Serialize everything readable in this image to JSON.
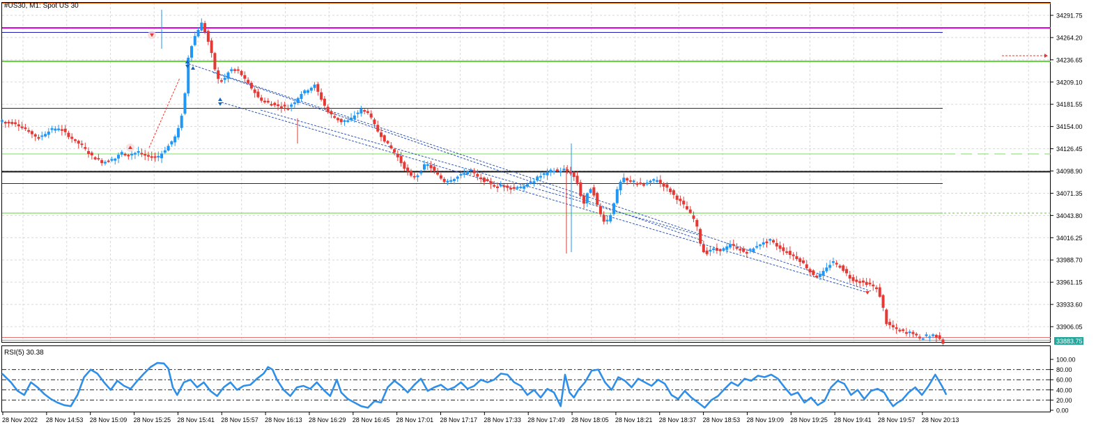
{
  "chart": {
    "symbol_label": "#US30, M1:  Spot US 30",
    "price_axis": [
      "34291.75",
      "34264.20",
      "34236.65",
      "34209.10",
      "34181.55",
      "34154.00",
      "34126.45",
      "34098.90",
      "34071.35",
      "34043.80",
      "34016.25",
      "33988.70",
      "33961.15",
      "33933.60",
      "33906.05"
    ],
    "current_price": "33883.75",
    "colors": {
      "bull": "#2196f3",
      "bear": "#e53935",
      "accent": "#26a69a"
    }
  },
  "rsi": {
    "label": "RSI(5) 30.38",
    "axis": [
      "100.00",
      "80.00",
      "60.00",
      "40.00",
      "20.00",
      "0.00"
    ]
  },
  "time_axis": [
    "28 Nov 2022",
    "28 Nov 14:53",
    "28 Nov 15:09",
    "28 Nov 15:25",
    "28 Nov 15:41",
    "28 Nov 15:57",
    "28 Nov 16:13",
    "28 Nov 16:29",
    "28 Nov 16:45",
    "28 Nov 17:01",
    "28 Nov 17:17",
    "28 Nov 17:33",
    "28 Nov 17:49",
    "28 Nov 18:05",
    "28 Nov 18:21",
    "28 Nov 18:37",
    "28 Nov 18:53",
    "28 Nov 19:09",
    "28 Nov 19:25",
    "28 Nov 19:41",
    "28 Nov 19:57",
    "28 Nov 20:13"
  ],
  "chart_data": [
    {
      "type": "candlestick",
      "interval": "M1",
      "price_labels": [
        34291.75,
        34264.2,
        34236.65,
        34209.1,
        34181.55,
        34154.0,
        34126.45,
        34098.9,
        34071.35,
        34043.8,
        34016.25,
        33988.7,
        33961.15,
        33933.6,
        33906.05
      ],
      "ylim": [
        33883,
        34305
      ],
      "close_path": [
        [
          0,
          34160
        ],
        [
          12,
          34158
        ],
        [
          22,
          34150
        ],
        [
          32,
          34140
        ],
        [
          42,
          34148
        ],
        [
          52,
          34152
        ],
        [
          62,
          34140
        ],
        [
          72,
          34130
        ],
        [
          80,
          34118
        ],
        [
          90,
          34110
        ],
        [
          100,
          34112
        ],
        [
          108,
          34122
        ],
        [
          115,
          34118
        ],
        [
          122,
          34122
        ],
        [
          130,
          34118
        ],
        [
          140,
          34115
        ],
        [
          150,
          34130
        ],
        [
          158,
          34145
        ],
        [
          164,
          34180
        ],
        [
          168,
          34240
        ],
        [
          172,
          34260
        ],
        [
          176,
          34272
        ],
        [
          180,
          34282
        ],
        [
          184,
          34268
        ],
        [
          188,
          34250
        ],
        [
          192,
          34225
        ],
        [
          196,
          34208
        ],
        [
          200,
          34212
        ],
        [
          206,
          34225
        ],
        [
          214,
          34222
        ],
        [
          220,
          34210
        ],
        [
          226,
          34200
        ],
        [
          232,
          34188
        ],
        [
          240,
          34184
        ],
        [
          250,
          34180
        ],
        [
          258,
          34178
        ],
        [
          264,
          34185
        ],
        [
          270,
          34195
        ],
        [
          276,
          34200
        ],
        [
          282,
          34205
        ],
        [
          288,
          34188
        ],
        [
          294,
          34172
        ],
        [
          300,
          34165
        ],
        [
          306,
          34160
        ],
        [
          312,
          34160
        ],
        [
          318,
          34168
        ],
        [
          324,
          34175
        ],
        [
          330,
          34172
        ],
        [
          338,
          34150
        ],
        [
          346,
          34135
        ],
        [
          354,
          34122
        ],
        [
          362,
          34105
        ],
        [
          370,
          34090
        ],
        [
          376,
          34095
        ],
        [
          382,
          34108
        ],
        [
          388,
          34102
        ],
        [
          394,
          34092
        ],
        [
          400,
          34085
        ],
        [
          408,
          34090
        ],
        [
          416,
          34095
        ],
        [
          422,
          34100
        ],
        [
          430,
          34090
        ],
        [
          438,
          34085
        ],
        [
          446,
          34080
        ],
        [
          454,
          34080
        ],
        [
          462,
          34078
        ],
        [
          470,
          34078
        ],
        [
          478,
          34085
        ],
        [
          484,
          34092
        ],
        [
          490,
          34095
        ],
        [
          496,
          34100
        ],
        [
          502,
          34098
        ],
        [
          508,
          34100
        ],
        [
          514,
          34096
        ],
        [
          520,
          34082
        ],
        [
          524,
          34055
        ],
        [
          528,
          34070
        ],
        [
          532,
          34080
        ],
        [
          536,
          34060
        ],
        [
          540,
          34045
        ],
        [
          544,
          34035
        ],
        [
          548,
          34040
        ],
        [
          552,
          34060
        ],
        [
          556,
          34080
        ],
        [
          560,
          34090
        ],
        [
          566,
          34085
        ],
        [
          572,
          34085
        ],
        [
          578,
          34082
        ],
        [
          584,
          34085
        ],
        [
          590,
          34088
        ],
        [
          596,
          34082
        ],
        [
          602,
          34075
        ],
        [
          608,
          34066
        ],
        [
          614,
          34058
        ],
        [
          620,
          34048
        ],
        [
          626,
          34035
        ],
        [
          630,
          34010
        ],
        [
          634,
          33995
        ],
        [
          640,
          34002
        ],
        [
          646,
          34000
        ],
        [
          652,
          34003
        ],
        [
          658,
          34008
        ],
        [
          664,
          34003
        ],
        [
          670,
          33998
        ],
        [
          676,
          34000
        ],
        [
          682,
          34008
        ],
        [
          688,
          34010
        ],
        [
          694,
          34012
        ],
        [
          700,
          34005
        ],
        [
          706,
          34000
        ],
        [
          712,
          33995
        ],
        [
          718,
          33990
        ],
        [
          724,
          33983
        ],
        [
          730,
          33972
        ],
        [
          736,
          33968
        ],
        [
          742,
          33975
        ],
        [
          748,
          33985
        ],
        [
          754,
          33983
        ],
        [
          760,
          33975
        ],
        [
          766,
          33965
        ],
        [
          772,
          33962
        ],
        [
          778,
          33960
        ],
        [
          784,
          33958
        ],
        [
          790,
          33953
        ],
        [
          794,
          33935
        ],
        [
          798,
          33910
        ],
        [
          804,
          33905
        ],
        [
          810,
          33902
        ],
        [
          816,
          33900
        ],
        [
          822,
          33898
        ],
        [
          828,
          33892
        ],
        [
          834,
          33893
        ],
        [
          840,
          33895
        ],
        [
          846,
          33892
        ],
        [
          850,
          33883.75
        ]
      ],
      "current_price": 33883.75
    },
    {
      "type": "line",
      "name": "RSI(5)",
      "ylim": [
        0,
        100
      ],
      "y_labels": [
        100,
        80,
        60,
        40,
        20,
        0
      ],
      "last_value": 30.38,
      "path": [
        [
          0,
          72
        ],
        [
          8,
          55
        ],
        [
          14,
          38
        ],
        [
          20,
          30
        ],
        [
          26,
          55
        ],
        [
          32,
          45
        ],
        [
          38,
          32
        ],
        [
          44,
          22
        ],
        [
          50,
          15
        ],
        [
          56,
          10
        ],
        [
          62,
          8
        ],
        [
          68,
          30
        ],
        [
          74,
          65
        ],
        [
          80,
          80
        ],
        [
          86,
          72
        ],
        [
          92,
          55
        ],
        [
          98,
          40
        ],
        [
          104,
          58
        ],
        [
          110,
          48
        ],
        [
          116,
          42
        ],
        [
          122,
          58
        ],
        [
          128,
          72
        ],
        [
          134,
          85
        ],
        [
          140,
          93
        ],
        [
          146,
          92
        ],
        [
          150,
          82
        ],
        [
          154,
          45
        ],
        [
          158,
          30
        ],
        [
          164,
          55
        ],
        [
          170,
          60
        ],
        [
          176,
          45
        ],
        [
          182,
          55
        ],
        [
          188,
          38
        ],
        [
          194,
          28
        ],
        [
          200,
          45
        ],
        [
          206,
          55
        ],
        [
          212,
          40
        ],
        [
          218,
          48
        ],
        [
          224,
          50
        ],
        [
          230,
          62
        ],
        [
          236,
          72
        ],
        [
          240,
          85
        ],
        [
          244,
          80
        ],
        [
          248,
          60
        ],
        [
          254,
          40
        ],
        [
          260,
          28
        ],
        [
          266,
          45
        ],
        [
          272,
          48
        ],
        [
          278,
          42
        ],
        [
          284,
          55
        ],
        [
          290,
          40
        ],
        [
          296,
          28
        ],
        [
          302,
          60
        ],
        [
          306,
          35
        ],
        [
          312,
          22
        ],
        [
          318,
          15
        ],
        [
          324,
          8
        ],
        [
          330,
          5
        ],
        [
          336,
          18
        ],
        [
          342,
          15
        ],
        [
          348,
          45
        ],
        [
          354,
          58
        ],
        [
          360,
          48
        ],
        [
          366,
          35
        ],
        [
          372,
          50
        ],
        [
          378,
          62
        ],
        [
          384,
          38
        ],
        [
          390,
          45
        ],
        [
          396,
          50
        ],
        [
          402,
          40
        ],
        [
          408,
          45
        ],
        [
          414,
          55
        ],
        [
          420,
          42
        ],
        [
          426,
          48
        ],
        [
          432,
          60
        ],
        [
          438,
          55
        ],
        [
          444,
          60
        ],
        [
          450,
          72
        ],
        [
          456,
          70
        ],
        [
          462,
          55
        ],
        [
          468,
          48
        ],
        [
          474,
          30
        ],
        [
          480,
          40
        ],
        [
          486,
          25
        ],
        [
          492,
          42
        ],
        [
          498,
          35
        ],
        [
          504,
          8
        ],
        [
          508,
          70
        ],
        [
          512,
          35
        ],
        [
          516,
          25
        ],
        [
          520,
          40
        ],
        [
          526,
          55
        ],
        [
          532,
          78
        ],
        [
          538,
          80
        ],
        [
          544,
          55
        ],
        [
          550,
          40
        ],
        [
          556,
          65
        ],
        [
          562,
          58
        ],
        [
          568,
          45
        ],
        [
          574,
          62
        ],
        [
          580,
          55
        ],
        [
          586,
          48
        ],
        [
          592,
          60
        ],
        [
          598,
          52
        ],
        [
          604,
          30
        ],
        [
          610,
          22
        ],
        [
          616,
          38
        ],
        [
          622,
          25
        ],
        [
          628,
          15
        ],
        [
          634,
          5
        ],
        [
          640,
          20
        ],
        [
          646,
          28
        ],
        [
          652,
          42
        ],
        [
          658,
          55
        ],
        [
          664,
          48
        ],
        [
          670,
          62
        ],
        [
          676,
          58
        ],
        [
          682,
          68
        ],
        [
          688,
          65
        ],
        [
          694,
          70
        ],
        [
          700,
          62
        ],
        [
          706,
          45
        ],
        [
          712,
          30
        ],
        [
          718,
          35
        ],
        [
          724,
          15
        ],
        [
          730,
          25
        ],
        [
          736,
          10
        ],
        [
          742,
          18
        ],
        [
          748,
          45
        ],
        [
          754,
          58
        ],
        [
          760,
          52
        ],
        [
          766,
          30
        ],
        [
          772,
          40
        ],
        [
          778,
          22
        ],
        [
          784,
          38
        ],
        [
          790,
          42
        ],
        [
          796,
          35
        ],
        [
          800,
          20
        ],
        [
          804,
          8
        ],
        [
          808,
          15
        ],
        [
          812,
          20
        ],
        [
          818,
          35
        ],
        [
          824,
          45
        ],
        [
          830,
          30
        ],
        [
          836,
          48
        ],
        [
          842,
          70
        ],
        [
          848,
          48
        ],
        [
          852,
          30.38
        ]
      ]
    }
  ]
}
